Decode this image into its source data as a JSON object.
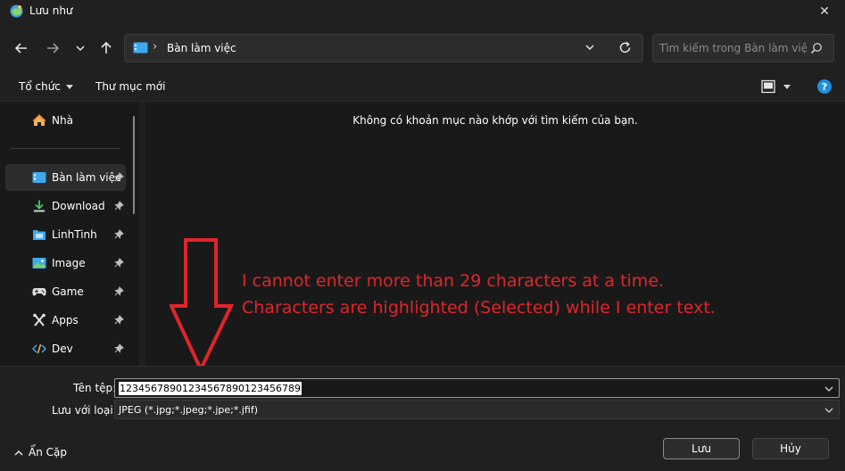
{
  "window": {
    "title": "Lưu như",
    "close_glyph": "✕"
  },
  "nav": {
    "path": "Bàn làm việc",
    "separator": "›",
    "search_placeholder": "Tìm kiếm trong Bàn làm việc"
  },
  "toolbar": {
    "organize": "Tổ chức",
    "new_folder": "Thư mục mới",
    "help": "?"
  },
  "sidebar": {
    "home": "Nhà",
    "items": [
      {
        "label": "Bàn làm việc",
        "icon": "desktop-icon"
      },
      {
        "label": "Download",
        "icon": "download-icon"
      },
      {
        "label": "LinhTinh",
        "icon": "folder-icon"
      },
      {
        "label": "Image",
        "icon": "image-icon"
      },
      {
        "label": "Game",
        "icon": "gamepad-icon"
      },
      {
        "label": "Apps",
        "icon": "apps-icon"
      },
      {
        "label": "Dev",
        "icon": "code-icon"
      }
    ]
  },
  "content": {
    "empty_message": "Không có khoản mục nào khớp với tìm kiếm của bạn."
  },
  "annotation": {
    "line1": "I cannot enter more than 29 characters at a time.",
    "line2": "Characters are highlighted (Selected) while I enter text.",
    "color": "#e0252b"
  },
  "form": {
    "filename_label": "Tên tệp:",
    "filename_value": "12345678901234567890123456789",
    "filetype_label": "Lưu với loại:",
    "filetype_value": "JPEG (*.jpg;*.jpeg;*.jpe;*.jfif)"
  },
  "footer": {
    "hide_folders": "Ẩn Cặp",
    "save": "Lưu",
    "cancel": "Hủy"
  }
}
